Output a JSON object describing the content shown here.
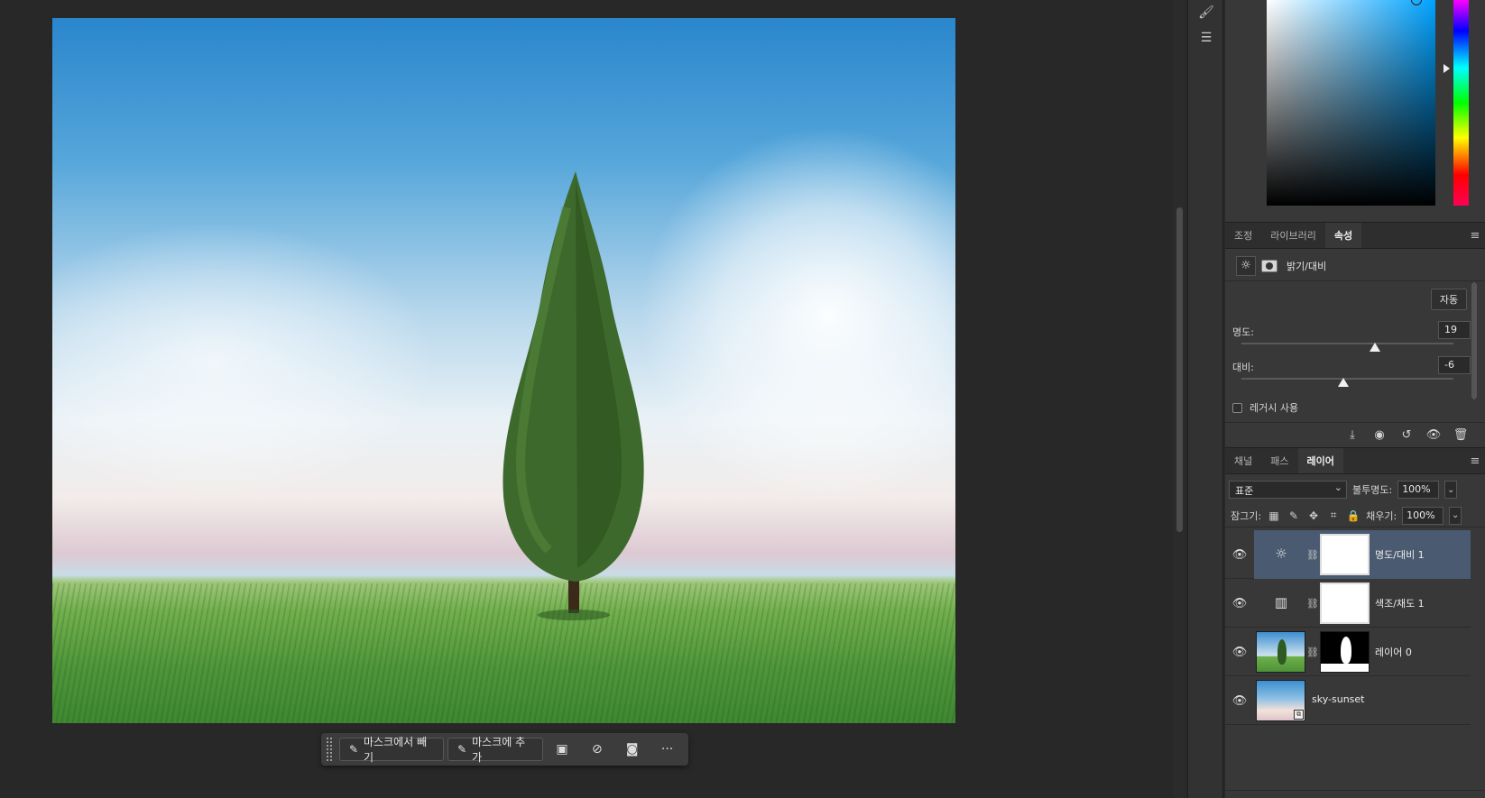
{
  "task_bar": {
    "subtract_label": "마스크에서 빼기",
    "add_label": "마스크에 추가",
    "more_label": "···"
  },
  "properties_panel": {
    "tabs": [
      {
        "label": "조정",
        "active": false
      },
      {
        "label": "라이브러리",
        "active": false
      },
      {
        "label": "속성",
        "active": true
      }
    ],
    "title": "밝기/대비",
    "auto_label": "자동",
    "brightness": {
      "label": "명도:",
      "value": "19",
      "level": 0.63
    },
    "contrast": {
      "label": "대비:",
      "value": "-6",
      "level": 0.48
    },
    "legacy_label": "레거시 사용",
    "legacy_checked": false
  },
  "layers_panel": {
    "tabs": [
      {
        "label": "채널",
        "active": false
      },
      {
        "label": "패스",
        "active": false
      },
      {
        "label": "레이어",
        "active": true
      }
    ],
    "blend_mode": "표준",
    "opacity_label": "불투명도:",
    "opacity_value": "100%",
    "lock_label": "잠그기:",
    "fill_label": "채우기:",
    "fill_value": "100%",
    "layers": [
      {
        "name": "명도/대비 1",
        "type": "adjustment-brightness",
        "selected": true,
        "visible": true
      },
      {
        "name": "색조/채도 1",
        "type": "adjustment-hue",
        "selected": false,
        "visible": true
      },
      {
        "name": "레이어 0",
        "type": "pixel-masked",
        "selected": false,
        "visible": true
      },
      {
        "name": "sky-sunset",
        "type": "smart-object",
        "selected": false,
        "visible": true
      }
    ]
  },
  "colors": {
    "selected_layer": "#4a5a70",
    "panel_bg": "#383838",
    "workspace_bg": "#282828"
  }
}
